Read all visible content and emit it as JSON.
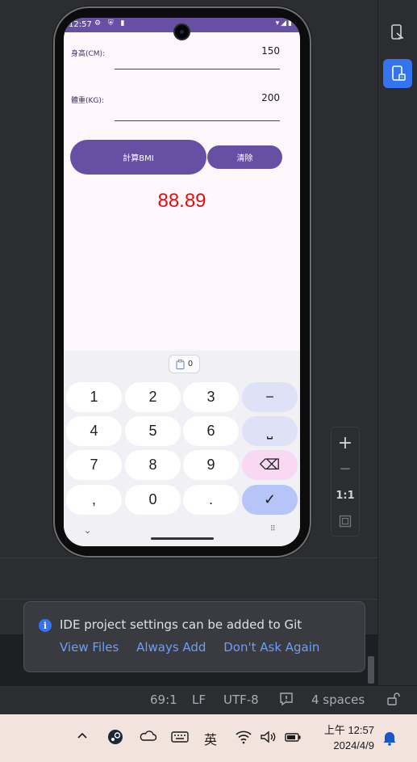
{
  "phone": {
    "status_time": "12:57",
    "status_icons": "⚙ ⛨ ▮",
    "status_right": "▾◢▮",
    "height_label": "身高(CM):",
    "height_value": "150",
    "weight_label": "體重(KG):",
    "weight_value": "200",
    "calc_button": "計算BMI",
    "clear_button": "清除",
    "result": "88.89"
  },
  "keyboard": {
    "clipboard_count": "0",
    "keys": [
      "1",
      "2",
      "3",
      "−",
      "4",
      "5",
      "6",
      "⎵",
      "7",
      "8",
      "9",
      "⌫",
      ",",
      "0",
      ".",
      "✓"
    ],
    "nav_left": "⌄",
    "nav_right": "⠿"
  },
  "notification": {
    "message": "IDE project settings can be added to Git",
    "actions": [
      "View Files",
      "Always Add",
      "Don't Ask Again"
    ]
  },
  "ide_status": {
    "position": "69:1",
    "line_ending": "LF",
    "encoding": "UTF-8",
    "indent": "4 spaces"
  },
  "zoom": {
    "zoom_in": "+",
    "zoom_out": "—",
    "actual": "1:1"
  },
  "taskbar": {
    "ime": "英",
    "clock_time": "上午 12:57",
    "clock_date": "2024/4/9"
  },
  "colors": {
    "accent": "#6750a4",
    "result": "#e01010",
    "ide_link": "#6e9ff3",
    "ide_primary": "#3574f0"
  }
}
